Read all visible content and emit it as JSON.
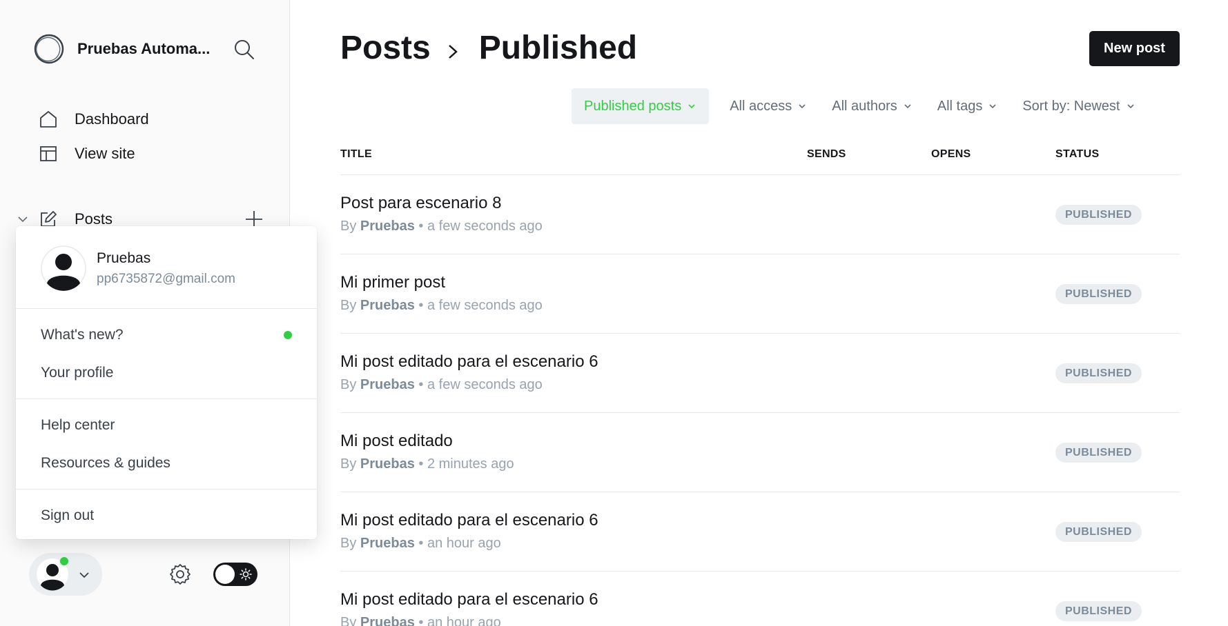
{
  "sidebar": {
    "site_name": "Pruebas Automa...",
    "nav": [
      {
        "label": "Dashboard",
        "icon": "home-icon"
      },
      {
        "label": "View site",
        "icon": "layout-icon"
      }
    ],
    "posts_label": "Posts"
  },
  "account_menu": {
    "user_name": "Pruebas",
    "user_email": "pp6735872@gmail.com",
    "whats_new": "What's new?",
    "your_profile": "Your profile",
    "help_center": "Help center",
    "resources": "Resources & guides",
    "sign_out": "Sign out"
  },
  "header": {
    "crumb_root": "Posts",
    "crumb_current": "Published",
    "new_post": "New post"
  },
  "filters": {
    "type": "Published posts",
    "access": "All access",
    "authors": "All authors",
    "tags": "All tags",
    "sort": "Sort by: Newest"
  },
  "table": {
    "headers": {
      "title": "TITLE",
      "sends": "SENDS",
      "opens": "OPENS",
      "status": "STATUS"
    },
    "rows": [
      {
        "title": "Post para escenario 8",
        "by": "By",
        "author": "Pruebas",
        "time": "• a few seconds ago",
        "status": "PUBLISHED"
      },
      {
        "title": "Mi primer post",
        "by": "By",
        "author": "Pruebas",
        "time": "• a few seconds ago",
        "status": "PUBLISHED"
      },
      {
        "title": "Mi post editado para el escenario 6",
        "by": "By",
        "author": "Pruebas",
        "time": "• a few seconds ago",
        "status": "PUBLISHED"
      },
      {
        "title": "Mi post editado",
        "by": "By",
        "author": "Pruebas",
        "time": "• 2 minutes ago",
        "status": "PUBLISHED"
      },
      {
        "title": "Mi post editado para el escenario 6",
        "by": "By",
        "author": "Pruebas",
        "time": "• an hour ago",
        "status": "PUBLISHED"
      },
      {
        "title": "Mi post editado para el escenario 6",
        "by": "By",
        "author": "Pruebas",
        "time": "• an hour ago",
        "status": "PUBLISHED"
      }
    ]
  },
  "colors": {
    "accent_green": "#30cf43",
    "text_dark": "#15171a",
    "muted": "#7c8b9a",
    "button_bg": "#15171a"
  }
}
